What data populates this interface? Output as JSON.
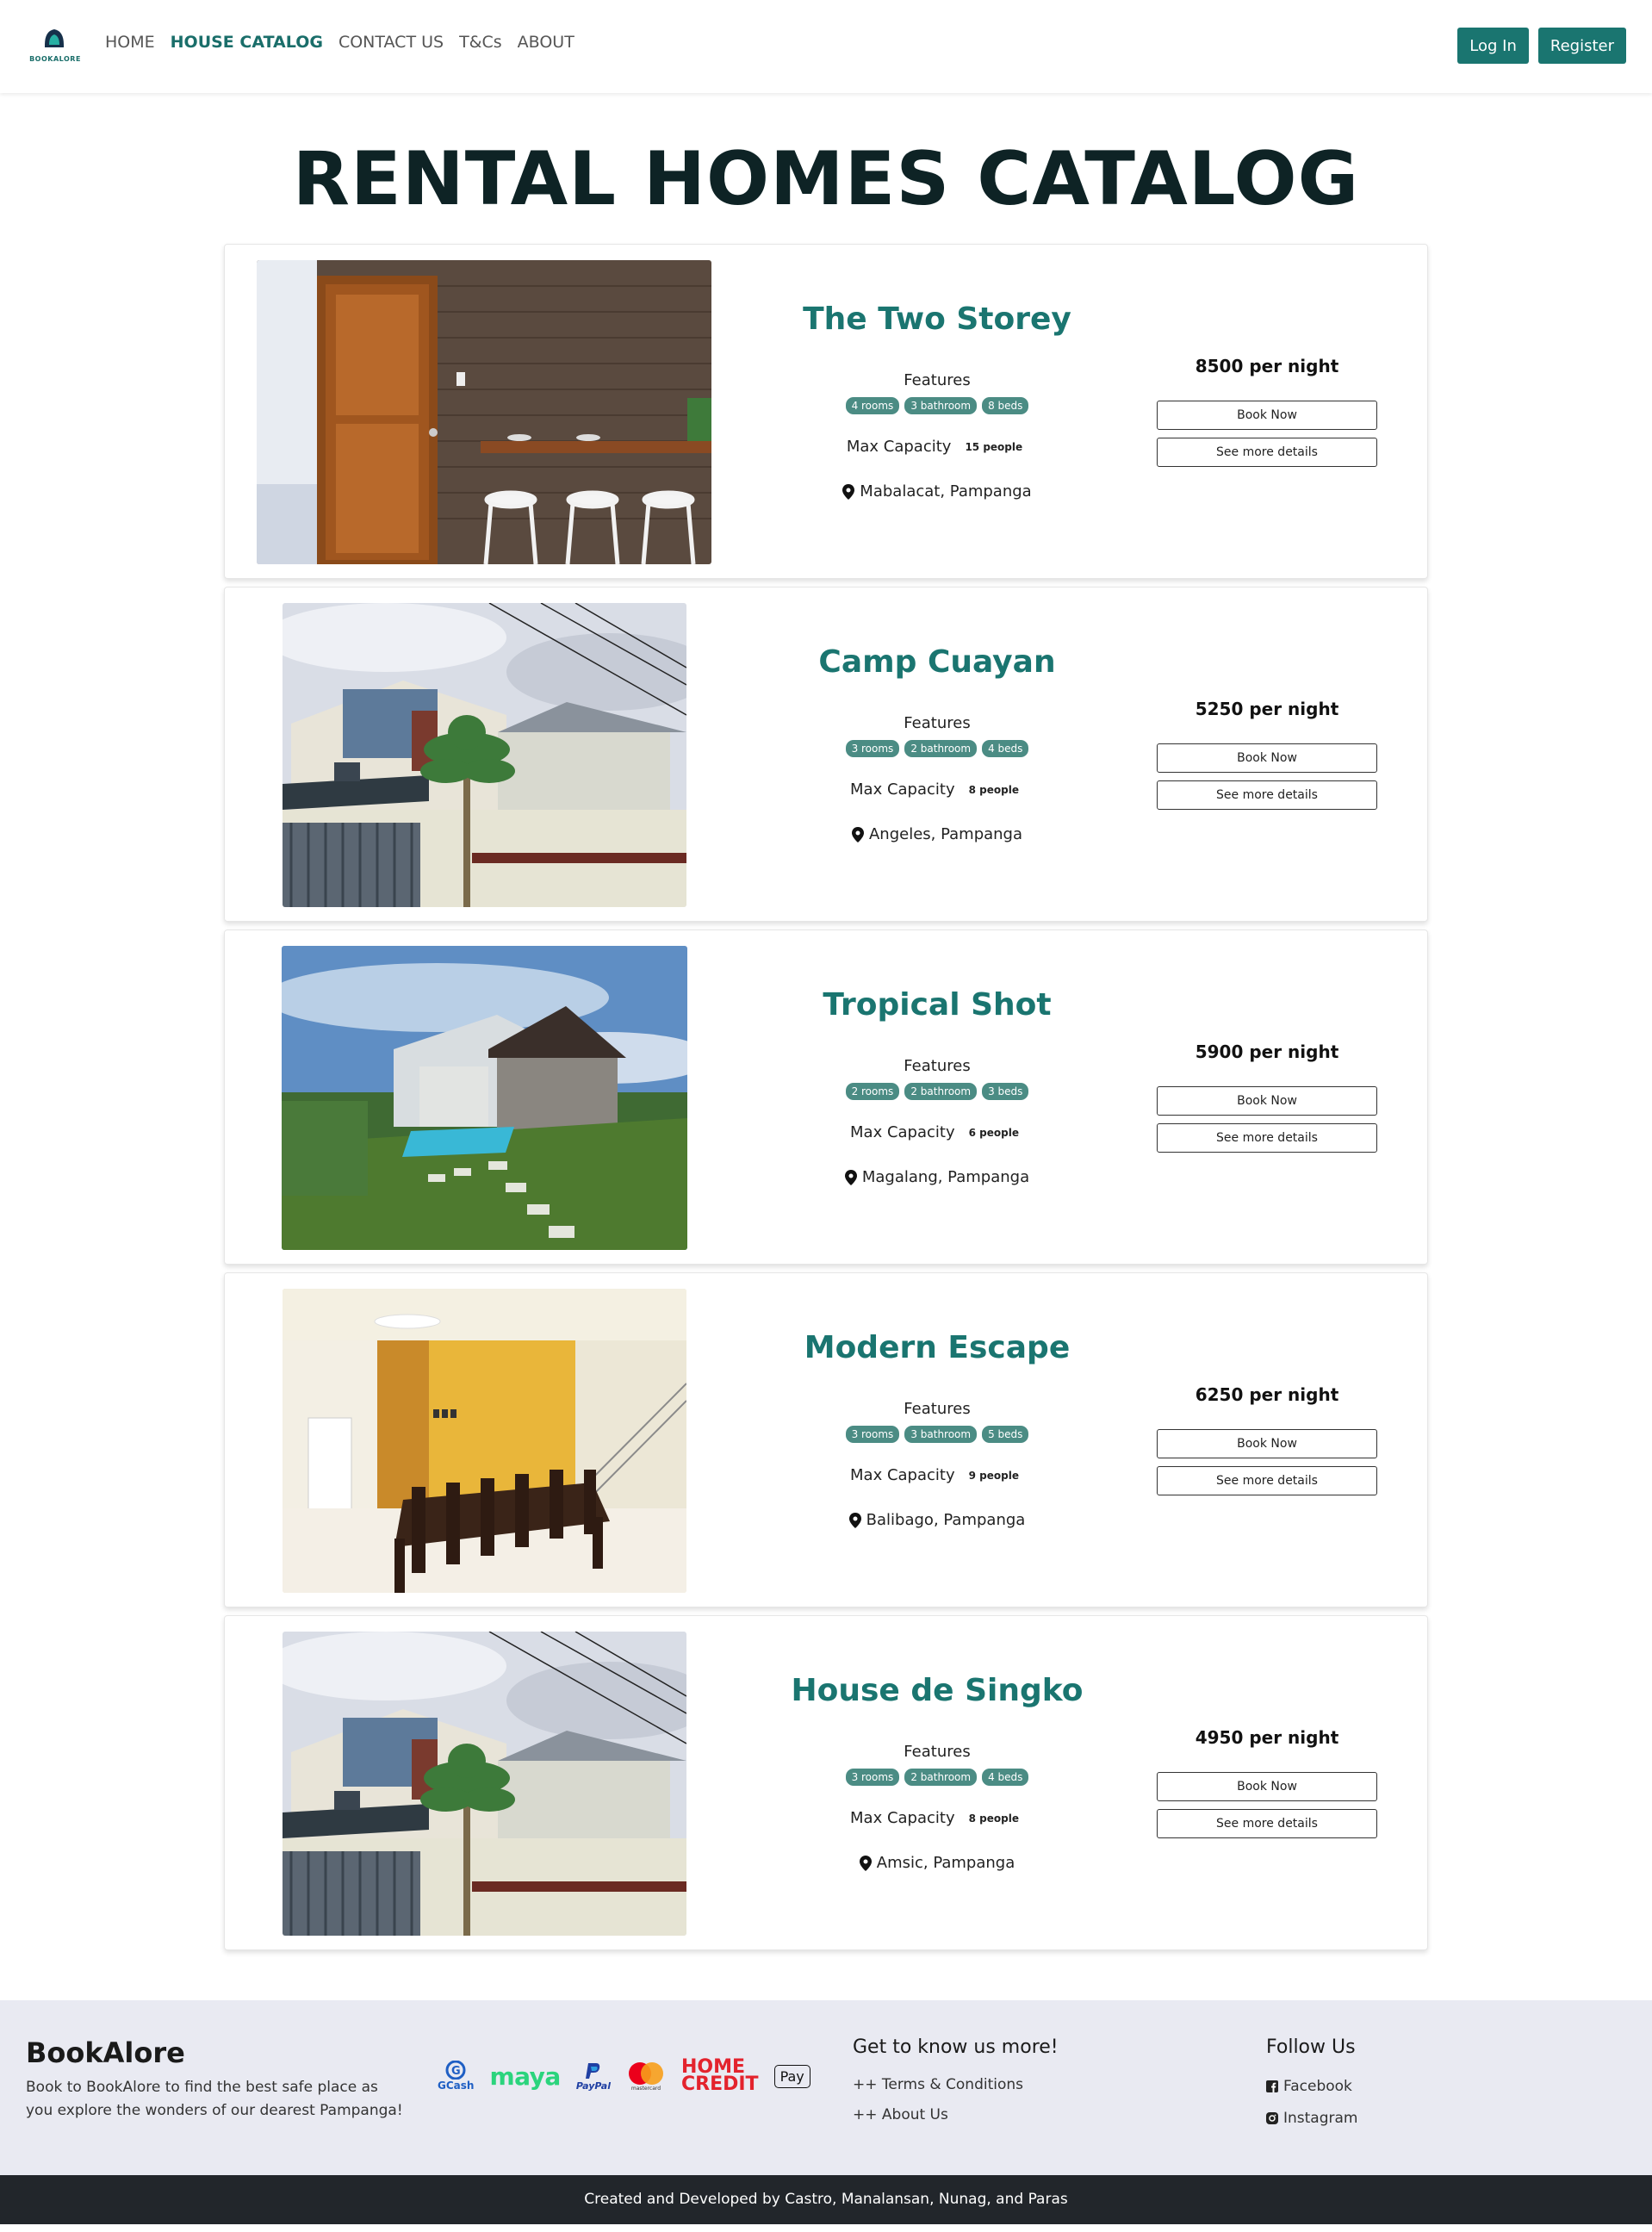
{
  "brand": {
    "logo_text": "BOOKALORE"
  },
  "nav": {
    "links": [
      "HOME",
      "HOUSE CATALOG",
      "CONTACT US",
      "T&Cs",
      "ABOUT"
    ],
    "active": "HOUSE CATALOG",
    "login_label": "Log In",
    "register_label": "Register"
  },
  "page": {
    "title": "RENTAL HOMES CATALOG"
  },
  "common": {
    "features_label": "Features",
    "capacity_label": "Max Capacity",
    "book_label": "Book Now",
    "details_label": "See more details"
  },
  "houses": [
    {
      "name": "The Two Storey",
      "rooms": "4 rooms",
      "bathrooms": "3 bathroom",
      "beds": "8 beds",
      "capacity": "15 people",
      "location": "Mabalacat, Pampanga",
      "price": "8500 per night",
      "image": "interior-door-bar-stools"
    },
    {
      "name": "Camp Cuayan",
      "rooms": "3 rooms",
      "bathrooms": "2 bathroom",
      "beds": "4 beds",
      "capacity": "8 people",
      "location": "Angeles, Pampanga",
      "price": "5250 per night",
      "image": "two-storey-house-palm"
    },
    {
      "name": "Tropical Shot",
      "rooms": "2 rooms",
      "bathrooms": "2 bathroom",
      "beds": "3 beds",
      "capacity": "6 people",
      "location": "Magalang, Pampanga",
      "price": "5900 per night",
      "image": "house-with-pool-lawn"
    },
    {
      "name": "Modern Escape",
      "rooms": "3 rooms",
      "bathrooms": "3 bathroom",
      "beds": "5 beds",
      "capacity": "9 people",
      "location": "Balibago, Pampanga",
      "price": "6250 per night",
      "image": "dining-room-stairs"
    },
    {
      "name": "House de Singko",
      "rooms": "3 rooms",
      "bathrooms": "2 bathroom",
      "beds": "4 beds",
      "capacity": "8 people",
      "location": "Amsic, Pampanga",
      "price": "4950 per night",
      "image": "two-storey-house-palm"
    }
  ],
  "footer": {
    "brand": "BookAlore",
    "description": "Book to BookAlore to find the best safe place as you explore the wonders of our dearest Pampanga!",
    "payments": {
      "gcash": "GCash",
      "maya": "maya",
      "paypal": "PayPal",
      "mastercard": "mastercard",
      "homecredit_1": "HOME",
      "homecredit_2": "CREDIT",
      "applepay": "Pay"
    },
    "know_more_title": "Get to know us more!",
    "know_more_links": [
      "++ Terms & Conditions",
      "++ About Us"
    ],
    "follow_title": "Follow Us",
    "social": [
      "Facebook",
      "Instagram"
    ],
    "credits": "Created and Developed by Castro, Manalansan, Nunag, and Paras"
  },
  "colors": {
    "accent": "#1a7570",
    "title": "#0e2325",
    "badge": "#4b8c84",
    "footer_bg": "#e9eaf2",
    "bottom_bar": "#22262b"
  }
}
